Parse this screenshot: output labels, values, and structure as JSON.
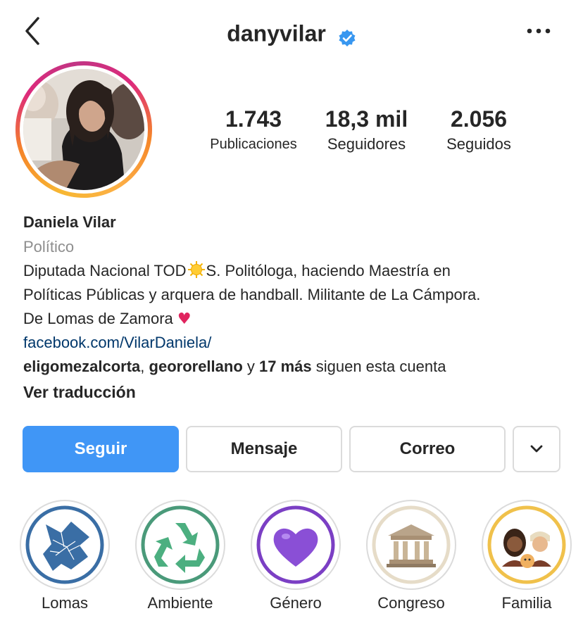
{
  "header": {
    "username": "danyvilar",
    "verified": true,
    "verified_color": "#3897f0",
    "back_icon": "chevron-left-icon",
    "more_icon": "more-horizontal-icon"
  },
  "stats": {
    "posts": {
      "value": "1.743",
      "label": "Publicaciones"
    },
    "followers": {
      "value": "18,3 mil",
      "label": "Seguidores"
    },
    "following": {
      "value": "2.056",
      "label": "Seguidos"
    }
  },
  "profile": {
    "name": "Daniela Vilar",
    "category": "Político",
    "bio_line1_pre": "Diputada Nacional TOD",
    "bio_line1_post": "S. Politóloga, haciendo Maestría en",
    "bio_line2": "Políticas Públicas y arquera de handball. Militante de La Cámpora.",
    "bio_line3": "De Lomas de Zamora ",
    "bio_heart": "❤️",
    "link": "facebook.com/VilarDaniela/",
    "followed_user1": "eligomezalcorta",
    "followed_sep": ", ",
    "followed_user2": "geororellano",
    "followed_and": " y ",
    "followed_more": "17 más",
    "followed_suffix": " siguen esta cuenta",
    "translate": "Ver traducción"
  },
  "actions": {
    "follow": "Seguir",
    "message": "Mensaje",
    "email": "Correo",
    "dropdown_icon": "chevron-down-icon",
    "accent": "#4096f6"
  },
  "highlights": [
    {
      "label": "Lomas",
      "icon": "map-icon"
    },
    {
      "label": "Ambiente",
      "icon": "recycle-icon"
    },
    {
      "label": "Género",
      "icon": "purple-heart-icon"
    },
    {
      "label": "Congreso",
      "icon": "classical-building-icon"
    },
    {
      "label": "Familia",
      "icon": "family-icon"
    }
  ]
}
